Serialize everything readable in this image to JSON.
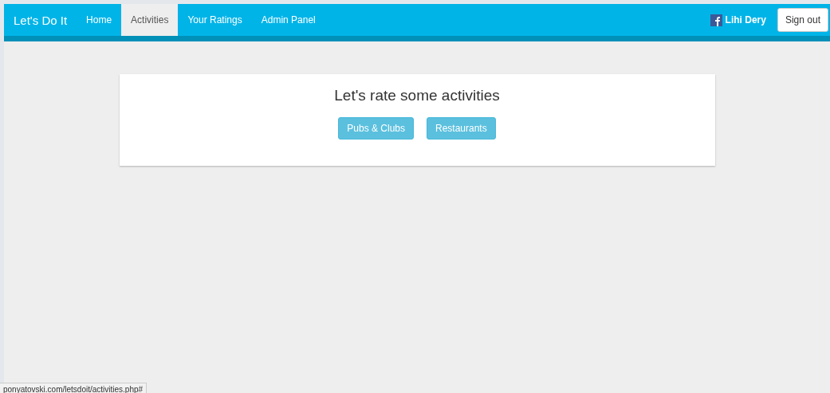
{
  "navbar": {
    "brand": "Let's Do It",
    "items": [
      {
        "label": "Home",
        "selected": false
      },
      {
        "label": "Activities",
        "selected": true
      },
      {
        "label": "Your Ratings",
        "selected": false
      },
      {
        "label": "Admin Panel",
        "selected": false
      }
    ],
    "user": "Lihi Dery",
    "sign_out": "Sign out"
  },
  "card": {
    "title": "Let's rate some activities",
    "buttons": [
      "Pubs & Clubs",
      "Restaurants"
    ]
  },
  "status_bar": {
    "url": "ponyatovski.com/letsdoit/activities.php#"
  }
}
